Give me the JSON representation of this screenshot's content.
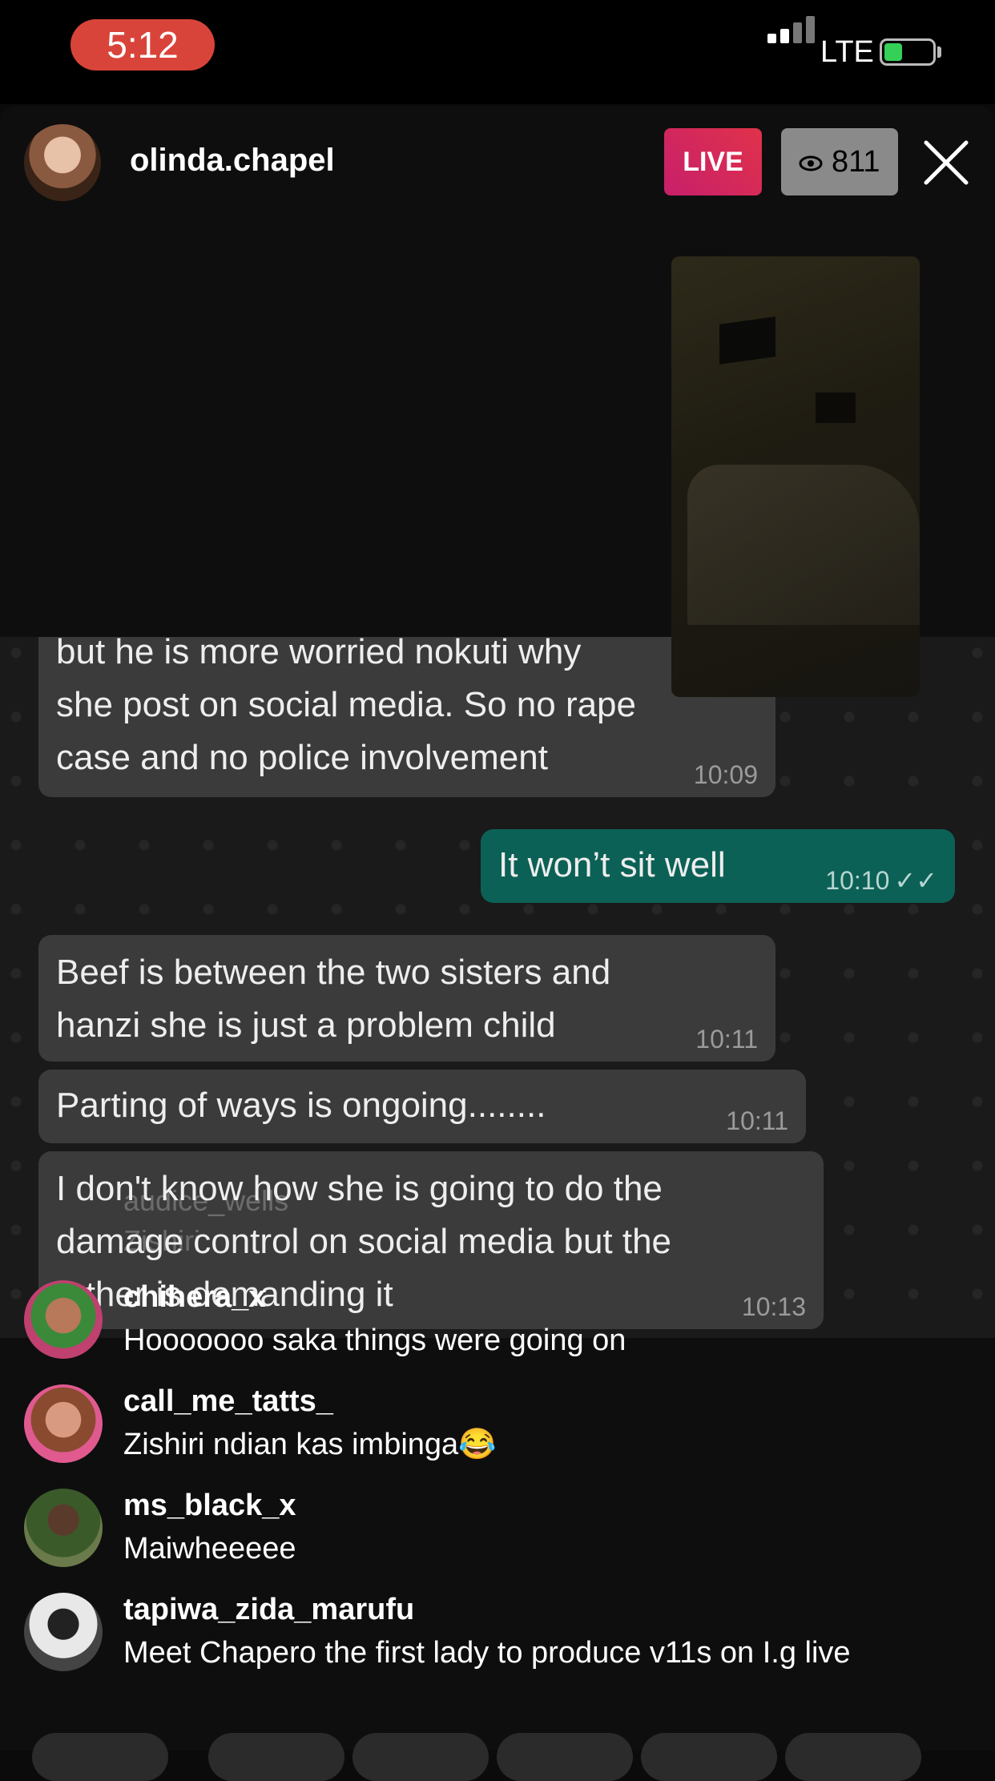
{
  "status": {
    "time": "5:12",
    "network": "LTE"
  },
  "live": {
    "host": "olinda.chapel",
    "badge": "LIVE",
    "viewers": "811"
  },
  "chat": {
    "messages": [
      {
        "lines": [
          "but he is more worried nokuti why",
          "she post on social media. So no rape",
          "case and no police involvement"
        ],
        "time": "10:09"
      },
      {
        "text": "It won’t sit well",
        "time": "10:10",
        "outgoing": true
      },
      {
        "lines": [
          "Beef is between the two sisters and",
          "hanzi she is just a problem child"
        ],
        "time": "10:11"
      },
      {
        "text": "Parting of ways is ongoing........",
        "time": "10:11"
      },
      {
        "lines": [
          "I don't know how she is going to do the",
          "damage control on social media but the",
          "father is demanding it"
        ],
        "time": "10:13"
      }
    ]
  },
  "ghosts": [
    "audice_wells",
    "Zishiri"
  ],
  "comments": [
    {
      "user": "chihera_x",
      "text": "Hooooooo saka things were going on"
    },
    {
      "user": "call_me_tatts_",
      "text": "Zishiri ndian kas imbinga😂"
    },
    {
      "user": "ms_black_x",
      "text": "Maiwheeeee"
    },
    {
      "user": "tapiwa_zida_marufu",
      "text": "Meet Chapero the first lady to produce v11s on I.g live"
    }
  ]
}
